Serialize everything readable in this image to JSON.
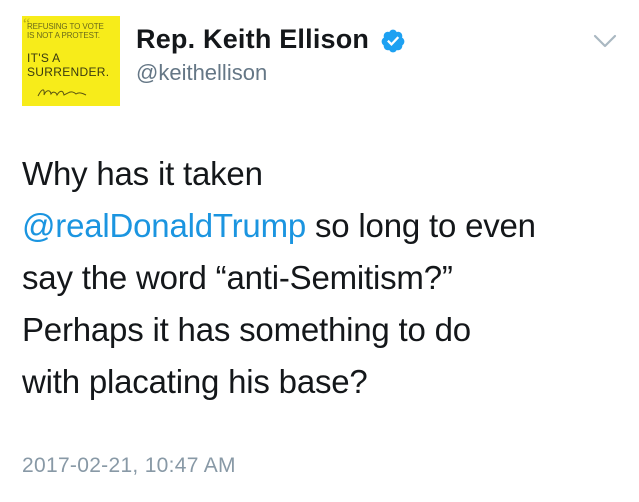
{
  "avatar": {
    "line1": "REFUSING TO VOTE",
    "line2": "IS NOT A PROTEST.",
    "line3": "IT'S A",
    "line4": "SURRENDER.",
    "color": "#f7ec1a"
  },
  "user": {
    "name": "Rep. Keith Ellison",
    "handle": "@keithellison",
    "verified_icon": "verified-badge-icon"
  },
  "tweet": {
    "line1": "Why has it taken",
    "mention": "@realDonaldTrump",
    "line2_rest": " so long to even",
    "line3": "say the word “anti-Semitism?”",
    "line4": "Perhaps it has something to do",
    "line5": "with placating his base?"
  },
  "timestamp": "2017-02-21, 10:47 AM",
  "colors": {
    "link": "#1b95e0",
    "muted": "#657786",
    "verified": "#1da1f2"
  }
}
